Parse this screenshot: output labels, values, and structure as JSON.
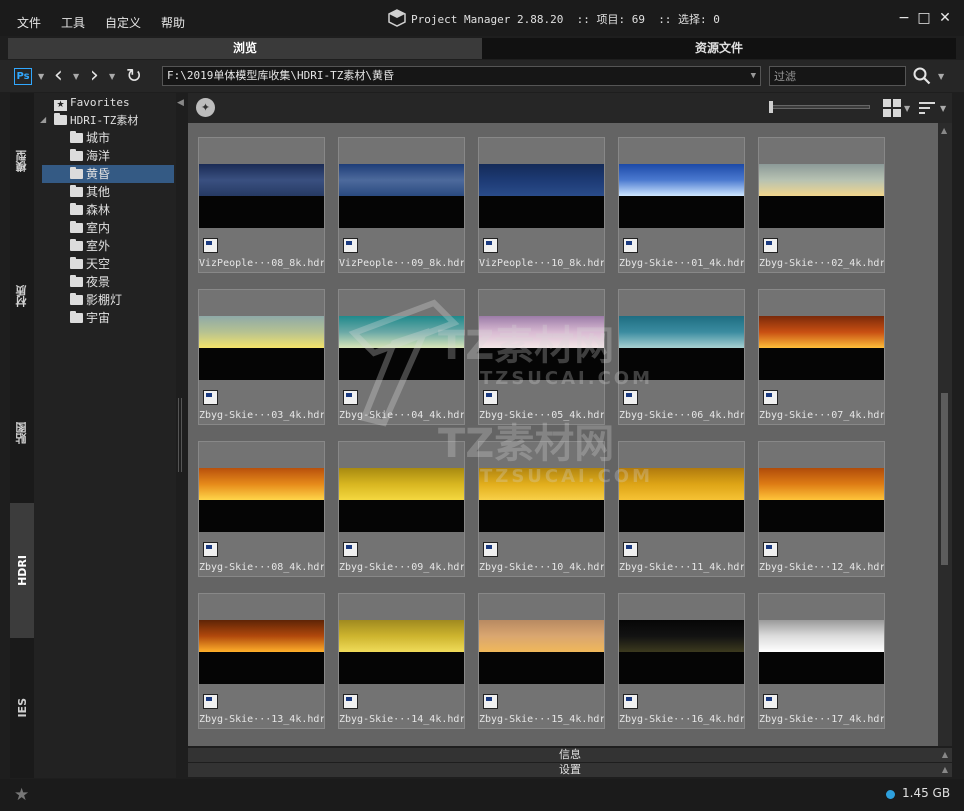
{
  "menu": [
    "文件",
    "工具",
    "自定义",
    "帮助"
  ],
  "title": {
    "app": "Project Manager 2.88.20",
    "items_label": ":: 项目: 69",
    "selection_label": ":: 选择: 0"
  },
  "window_controls": {
    "minimize": "−",
    "maximize": "□",
    "close": "✕"
  },
  "tabs": [
    {
      "label": "浏览",
      "active": true
    },
    {
      "label": "资源文件",
      "active": false
    }
  ],
  "toolbar": {
    "ps_label": "Ps",
    "path": "F:\\2019单体模型库收集\\HDRI-TZ素材\\黄昏",
    "filter_placeholder": "过滤"
  },
  "side_tabs": [
    {
      "label": "模型",
      "active": false
    },
    {
      "label": "材质",
      "active": false
    },
    {
      "label": "贴图",
      "active": false
    },
    {
      "label": "HDRI",
      "active": true
    },
    {
      "label": "IES",
      "active": false
    }
  ],
  "tree": {
    "favorites": "Favorites",
    "root": "HDRI-TZ素材",
    "folders": [
      {
        "label": "城市",
        "selected": false
      },
      {
        "label": "海洋",
        "selected": false
      },
      {
        "label": "黄昏",
        "selected": true
      },
      {
        "label": "其他",
        "selected": false
      },
      {
        "label": "森林",
        "selected": false
      },
      {
        "label": "室内",
        "selected": false
      },
      {
        "label": "室外",
        "selected": false
      },
      {
        "label": "天空",
        "selected": false
      },
      {
        "label": "夜景",
        "selected": false
      },
      {
        "label": "影棚灯",
        "selected": false
      },
      {
        "label": "宇宙",
        "selected": false
      }
    ]
  },
  "files": [
    {
      "label": "VizPeople···08_8k.hdr",
      "colors": [
        "#1a2b55",
        "#3a5080",
        "#263a64"
      ]
    },
    {
      "label": "VizPeople···09_8k.hdr",
      "colors": [
        "#1e3d78",
        "#4d6a9c",
        "#2a4a80"
      ]
    },
    {
      "label": "VizPeople···10_8k.hdr",
      "colors": [
        "#142a58",
        "#1d3a74",
        "#2a4c8a"
      ]
    },
    {
      "label": "Zbyg-Skie···01_4k.hdr",
      "colors": [
        "#1c4aa8",
        "#4b7ad0",
        "#cfe7ff"
      ]
    },
    {
      "label": "Zbyg-Skie···02_4k.hdr",
      "colors": [
        "#8c9a98",
        "#b7c2b2",
        "#f2d68c"
      ]
    },
    {
      "label": "Zbyg-Skie···03_4k.hdr",
      "colors": [
        "#8fa9a8",
        "#b6c291",
        "#f4e36a"
      ]
    },
    {
      "label": "Zbyg-Skie···04_4k.hdr",
      "colors": [
        "#1f8a8c",
        "#6aa8a6",
        "#d9e6b8"
      ]
    },
    {
      "label": "Zbyg-Skie···05_4k.hdr",
      "colors": [
        "#9c7ca8",
        "#d8bad2",
        "#f3e6e6"
      ]
    },
    {
      "label": "Zbyg-Skie···06_4k.hdr",
      "colors": [
        "#1e6d82",
        "#3b8ca0",
        "#a8d0d2"
      ]
    },
    {
      "label": "Zbyg-Skie···07_4k.hdr",
      "colors": [
        "#7a2a0a",
        "#c84f12",
        "#ffbe3a"
      ]
    },
    {
      "label": "Zbyg-Skie···08_4k.hdr",
      "colors": [
        "#b8500c",
        "#e68a1a",
        "#ffd54a"
      ]
    },
    {
      "label": "Zbyg-Skie···09_4k.hdr",
      "colors": [
        "#a88a10",
        "#d8b620",
        "#f4d840"
      ]
    },
    {
      "label": "Zbyg-Skie···10_4k.hdr",
      "colors": [
        "#b08410",
        "#e2ae1c",
        "#f8d048"
      ]
    },
    {
      "label": "Zbyg-Skie···11_4k.hdr",
      "colors": [
        "#b07a0e",
        "#dda416",
        "#f6c234"
      ]
    },
    {
      "label": "Zbyg-Skie···12_4k.hdr",
      "colors": [
        "#b04c0a",
        "#de7c14",
        "#ffc43a"
      ]
    },
    {
      "label": "Zbyg-Skie···13_4k.hdr",
      "colors": [
        "#5e2406",
        "#b0480c",
        "#ffb02a"
      ]
    },
    {
      "label": "Zbyg-Skie···14_4k.hdr",
      "colors": [
        "#a08a20",
        "#cdb42e",
        "#f0dc5a"
      ]
    },
    {
      "label": "Zbyg-Skie···15_4k.hdr",
      "colors": [
        "#b88a62",
        "#d9a670",
        "#f0b85a"
      ]
    },
    {
      "label": "Zbyg-Skie···16_4k.hdr",
      "colors": [
        "#060606",
        "#121212",
        "#3c3a1e"
      ]
    },
    {
      "label": "Zbyg-Skie···17_4k.hdr",
      "colors": [
        "#9a9a9a",
        "#dcdcdc",
        "#ffffff"
      ]
    }
  ],
  "bottom_panels": [
    "信息",
    "设置"
  ],
  "status": {
    "disk": "1.45 GB"
  },
  "watermark": {
    "cn": "TZ素材网",
    "en": "TZSUCAI.COM"
  },
  "accent": "#345a84"
}
